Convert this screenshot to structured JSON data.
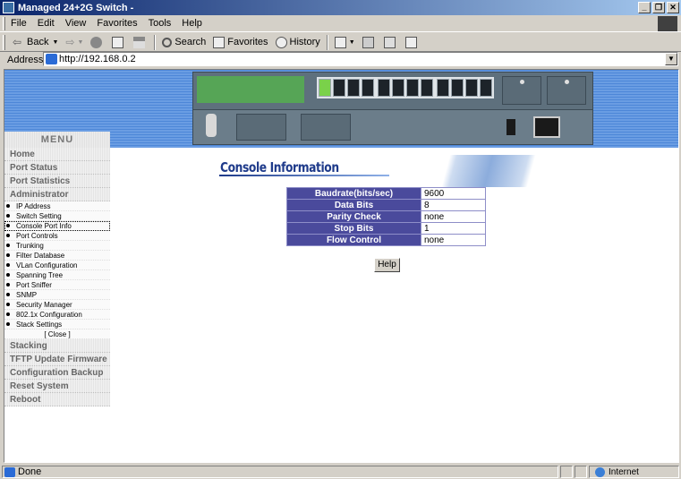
{
  "window": {
    "title": "Managed 24+2G Switch -"
  },
  "menubar": {
    "items": [
      "File",
      "Edit",
      "View",
      "Favorites",
      "Tools",
      "Help"
    ]
  },
  "toolbar": {
    "back": "Back",
    "search": "Search",
    "favorites": "Favorites",
    "history": "History"
  },
  "address": {
    "label": "Address",
    "url": "http://192.168.0.2"
  },
  "nav": {
    "title": "MENU",
    "main_top": [
      "Home",
      "Port Status",
      "Port Statistics",
      "Administrator"
    ],
    "sub_items": [
      "IP Address",
      "Switch Setting",
      "Console Port Info",
      "Port Controls",
      "Trunking",
      "Filter Database",
      "VLan Configuration",
      "Spanning Tree",
      "Port Sniffer",
      "SNMP",
      "Security Manager",
      "802.1x Configuration",
      "Stack Settings"
    ],
    "close": "[ Close ]",
    "main_bottom": [
      "Stacking",
      "TFTP Update Firmware",
      "Configuration Backup",
      "Reset System",
      "Reboot"
    ]
  },
  "page": {
    "title": "Console Information",
    "rows": [
      {
        "label": "Baudrate(bits/sec)",
        "value": "9600"
      },
      {
        "label": "Data Bits",
        "value": "8"
      },
      {
        "label": "Parity Check",
        "value": "none"
      },
      {
        "label": "Stop Bits",
        "value": "1"
      },
      {
        "label": "Flow Control",
        "value": "none"
      }
    ],
    "help_button": "Help"
  },
  "status": {
    "text": "Done",
    "zone": "Internet"
  }
}
